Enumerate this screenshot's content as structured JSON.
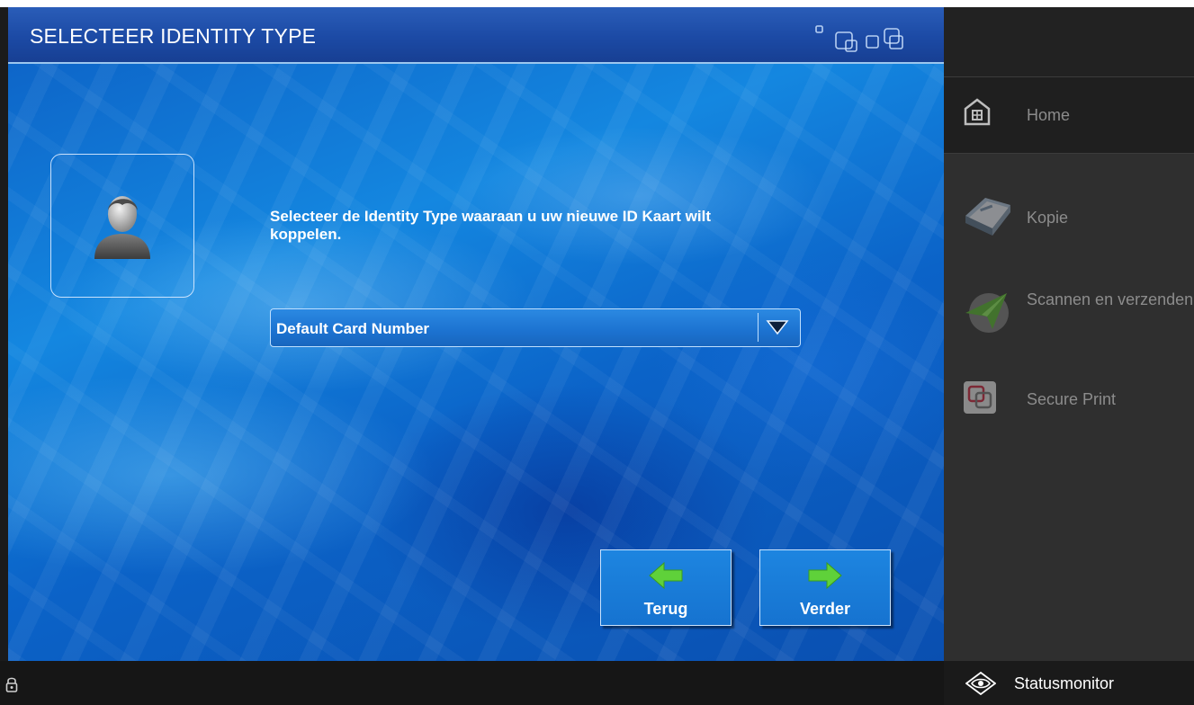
{
  "header": {
    "title": "SELECTEER IDENTITY TYPE"
  },
  "content": {
    "instruction": "Selecteer de Identity Type waaraan u uw nieuwe ID Kaart wilt koppelen.",
    "dropdown": {
      "selected": "Default Card Number"
    }
  },
  "buttons": {
    "back_label": "Terug",
    "next_label": "Verder"
  },
  "sidebar": {
    "items": [
      {
        "label": "Home",
        "icon": "home-icon"
      },
      {
        "label": "Kopie",
        "icon": "copy-icon"
      },
      {
        "label": "Scannen en verzenden",
        "icon": "scan-send-icon"
      },
      {
        "label": "Secure Print",
        "icon": "secure-print-icon"
      }
    ]
  },
  "statusbar": {
    "status_monitor_label": "Statusmonitor"
  },
  "colors": {
    "accent": "#1673d0",
    "arrow_green": "#5fd13a",
    "sidebar_bg": "#2f2f2f"
  }
}
